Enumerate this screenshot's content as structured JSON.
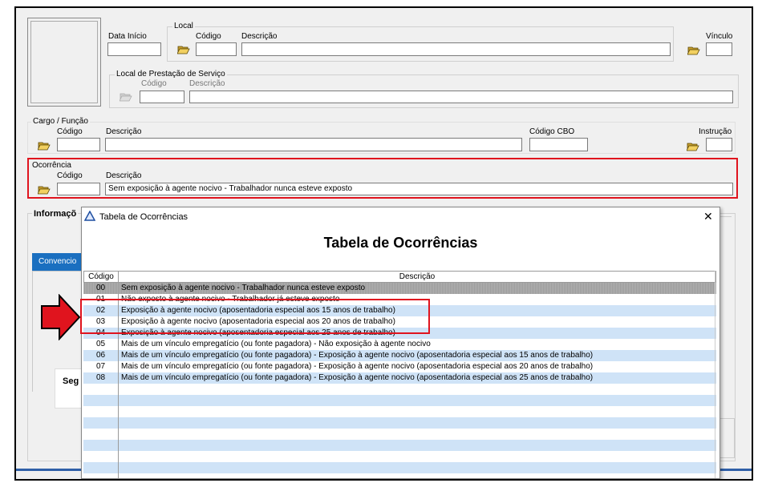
{
  "form": {
    "data_inicio_label": "Data Início",
    "local": {
      "title": "Local",
      "codigo_label": "Código",
      "descricao_label": "Descrição",
      "codigo_value": "",
      "descricao_value": ""
    },
    "vinculo_label": "Vínculo",
    "local_prestacao": {
      "title": "Local de Prestação de Serviço",
      "codigo_label": "Código",
      "descricao_label": "Descrição"
    },
    "cargo": {
      "title": "Cargo / Função",
      "codigo_label": "Código",
      "descricao_label": "Descrição",
      "cbo_label": "Código CBO",
      "instrucao_label": "Instrução"
    },
    "ocorrencia": {
      "title": "Ocorrência",
      "codigo_label": "Código",
      "descricao_label": "Descrição",
      "codigo_value": "",
      "descricao_value": "Sem exposição à agente nocivo - Trabalhador nunca esteve exposto"
    },
    "informacoes_title": "Informaçõ",
    "tab_convencional": "Convencio",
    "seg_label": "Seg"
  },
  "dialog": {
    "window_title": "Tabela de Ocorrências",
    "close_label": "✕",
    "heading": "Tabela de Ocorrências",
    "columns": [
      "Código",
      "Descrição"
    ],
    "rows": [
      {
        "code": "00",
        "desc": "Sem exposição à agente nocivo - Trabalhador nunca esteve exposto"
      },
      {
        "code": "01",
        "desc": "Não exposto à agente nocivo - Trabalhador já esteve exposto"
      },
      {
        "code": "02",
        "desc": "Exposição à agente nocivo (aposentadoria especial aos 15 anos de trabalho)"
      },
      {
        "code": "03",
        "desc": "Exposição à agente nocivo (aposentadoria especial aos 20 anos de trabalho)"
      },
      {
        "code": "04",
        "desc": "Exposição à agente nocivo (aposentadoria especial aos 25 anos de trabalho)"
      },
      {
        "code": "05",
        "desc": "Mais de um vínculo empregatício (ou fonte pagadora) - Não exposição à agente nocivo"
      },
      {
        "code": "06",
        "desc": "Mais de um vínculo empregatício (ou fonte pagadora) - Exposição à agente nocivo (aposentadoria especial aos 15 anos de trabalho)"
      },
      {
        "code": "07",
        "desc": "Mais de um vínculo empregatício (ou fonte pagadora) - Exposição à agente nocivo (aposentadoria especial aos 20 anos de trabalho)"
      },
      {
        "code": "08",
        "desc": "Mais de um vínculo empregatício (ou fonte pagadora) - Exposição à agente nocivo (aposentadoria especial aos 25 anos de trabalho)"
      }
    ],
    "empty_rows": 9,
    "selected_row_index": 0
  },
  "annotation": {
    "highlight_color": "#e0141e",
    "arrow_color": "#e0141e",
    "highlighted_codes": [
      "02",
      "03",
      "04"
    ]
  },
  "colors": {
    "stripe": "#cfe3f7",
    "tab_active": "#1a6fc0",
    "dialog_icon": "#1f4fa0"
  }
}
